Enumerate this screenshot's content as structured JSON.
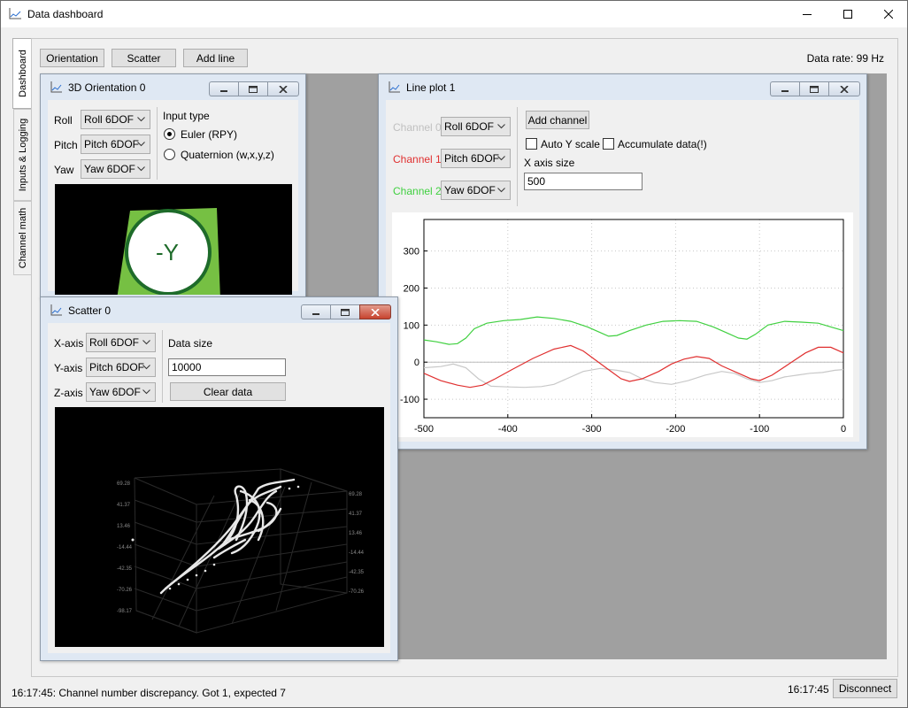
{
  "window": {
    "title": "Data dashboard",
    "icons": [
      "chart-app-icon",
      "minimize-icon",
      "maximize-icon",
      "close-icon"
    ]
  },
  "side_tabs": [
    {
      "label": "Dashboard",
      "active": true
    },
    {
      "label": "Inputs & Logging",
      "active": false
    },
    {
      "label": "Channel math",
      "active": false
    }
  ],
  "toolbar": {
    "orientation_label": "Orientation",
    "scatter_label": "Scatter",
    "add_line_label": "Add line",
    "data_rate": "Data rate: 99 Hz"
  },
  "orientation": {
    "title": "3D Orientation 0",
    "roll_label": "Roll",
    "roll_value": "Roll 6DOF",
    "pitch_label": "Pitch",
    "pitch_value": "Pitch 6DOF",
    "yaw_label": "Yaw",
    "yaw_value": "Yaw 6DOF",
    "input_type_label": "Input type",
    "euler_label": "Euler (RPY)",
    "quaternion_label": "Quaternion (w,x,y,z)",
    "selected_input": "euler",
    "face_label": "-Y",
    "face_color": "#76c043"
  },
  "scatter": {
    "title": "Scatter 0",
    "x_label": "X-axis",
    "x_value": "Roll 6DOF",
    "y_label": "Y-axis",
    "y_value": "Pitch 6DOF",
    "z_label": "Z-axis",
    "z_value": "Yaw 6DOF",
    "data_size_label": "Data size",
    "data_size_value": "10000",
    "clear_label": "Clear data",
    "axis_ticks_left": [
      "69.28",
      "41.37",
      "13.46",
      "-14.44",
      "-42.35",
      "-70.26",
      "-98.17"
    ],
    "axis_ticks_right": [
      "69.28",
      "41.37",
      "13.46",
      "-14.44",
      "-42.35",
      "-70.26"
    ]
  },
  "lineplot": {
    "title": "Line plot 1",
    "channels": [
      {
        "label": "Channel 0",
        "value": "Roll 6DOF",
        "color": "#c0c0c0"
      },
      {
        "label": "Channel 1",
        "value": "Pitch 6DOF",
        "color": "#e03030"
      },
      {
        "label": "Channel 2",
        "value": "Yaw 6DOF",
        "color": "#40d040"
      }
    ],
    "add_channel_label": "Add channel",
    "auto_y_label": "Auto Y scale",
    "accumulate_label": "Accumulate data(!)",
    "x_axis_size_label": "X axis size",
    "x_axis_size_value": "500"
  },
  "chart_data": {
    "type": "line",
    "x_ticks": [
      -500,
      -400,
      -300,
      -200,
      -100,
      0
    ],
    "y_ticks": [
      300,
      200,
      100,
      0,
      -100
    ],
    "xlim": [
      -500,
      0
    ],
    "ylim": [
      -150,
      385
    ],
    "grid": true,
    "series": [
      {
        "color": "#c8c8c8",
        "points": [
          [
            -500,
            -15
          ],
          [
            -480,
            -12
          ],
          [
            -465,
            -5
          ],
          [
            -450,
            -15
          ],
          [
            -435,
            -45
          ],
          [
            -420,
            -65
          ],
          [
            -400,
            -67
          ],
          [
            -380,
            -68
          ],
          [
            -360,
            -66
          ],
          [
            -345,
            -60
          ],
          [
            -330,
            -45
          ],
          [
            -310,
            -25
          ],
          [
            -290,
            -17
          ],
          [
            -270,
            -22
          ],
          [
            -255,
            -28
          ],
          [
            -240,
            -45
          ],
          [
            -225,
            -55
          ],
          [
            -205,
            -60
          ],
          [
            -185,
            -50
          ],
          [
            -165,
            -35
          ],
          [
            -145,
            -25
          ],
          [
            -130,
            -30
          ],
          [
            -115,
            -45
          ],
          [
            -100,
            -55
          ],
          [
            -85,
            -50
          ],
          [
            -70,
            -40
          ],
          [
            -55,
            -35
          ],
          [
            -40,
            -30
          ],
          [
            -25,
            -28
          ],
          [
            -10,
            -22
          ],
          [
            0,
            -20
          ]
        ]
      },
      {
        "color": "#e03030",
        "points": [
          [
            -500,
            -30
          ],
          [
            -480,
            -50
          ],
          [
            -460,
            -62
          ],
          [
            -445,
            -68
          ],
          [
            -430,
            -62
          ],
          [
            -415,
            -45
          ],
          [
            -395,
            -20
          ],
          [
            -370,
            10
          ],
          [
            -345,
            35
          ],
          [
            -325,
            45
          ],
          [
            -310,
            30
          ],
          [
            -295,
            5
          ],
          [
            -280,
            -20
          ],
          [
            -265,
            -45
          ],
          [
            -255,
            -52
          ],
          [
            -240,
            -45
          ],
          [
            -220,
            -25
          ],
          [
            -205,
            -5
          ],
          [
            -190,
            8
          ],
          [
            -175,
            15
          ],
          [
            -160,
            10
          ],
          [
            -145,
            -10
          ],
          [
            -125,
            -30
          ],
          [
            -110,
            -45
          ],
          [
            -100,
            -50
          ],
          [
            -85,
            -35
          ],
          [
            -65,
            -5
          ],
          [
            -45,
            25
          ],
          [
            -30,
            40
          ],
          [
            -15,
            40
          ],
          [
            0,
            25
          ]
        ]
      },
      {
        "color": "#40d040",
        "points": [
          [
            -500,
            60
          ],
          [
            -485,
            55
          ],
          [
            -470,
            48
          ],
          [
            -460,
            50
          ],
          [
            -450,
            65
          ],
          [
            -440,
            90
          ],
          [
            -425,
            105
          ],
          [
            -405,
            112
          ],
          [
            -385,
            115
          ],
          [
            -365,
            122
          ],
          [
            -345,
            118
          ],
          [
            -325,
            110
          ],
          [
            -305,
            95
          ],
          [
            -290,
            80
          ],
          [
            -280,
            70
          ],
          [
            -270,
            72
          ],
          [
            -255,
            85
          ],
          [
            -235,
            100
          ],
          [
            -215,
            110
          ],
          [
            -195,
            112
          ],
          [
            -175,
            110
          ],
          [
            -155,
            95
          ],
          [
            -140,
            80
          ],
          [
            -125,
            65
          ],
          [
            -115,
            62
          ],
          [
            -105,
            75
          ],
          [
            -90,
            100
          ],
          [
            -70,
            110
          ],
          [
            -50,
            108
          ],
          [
            -30,
            105
          ],
          [
            -15,
            95
          ],
          [
            0,
            85
          ]
        ]
      }
    ]
  },
  "status": {
    "message": "16:17:45: Channel number discrepancy. Got 1, expected 7",
    "time": "16:17:45",
    "disconnect_label": "Disconnect"
  }
}
